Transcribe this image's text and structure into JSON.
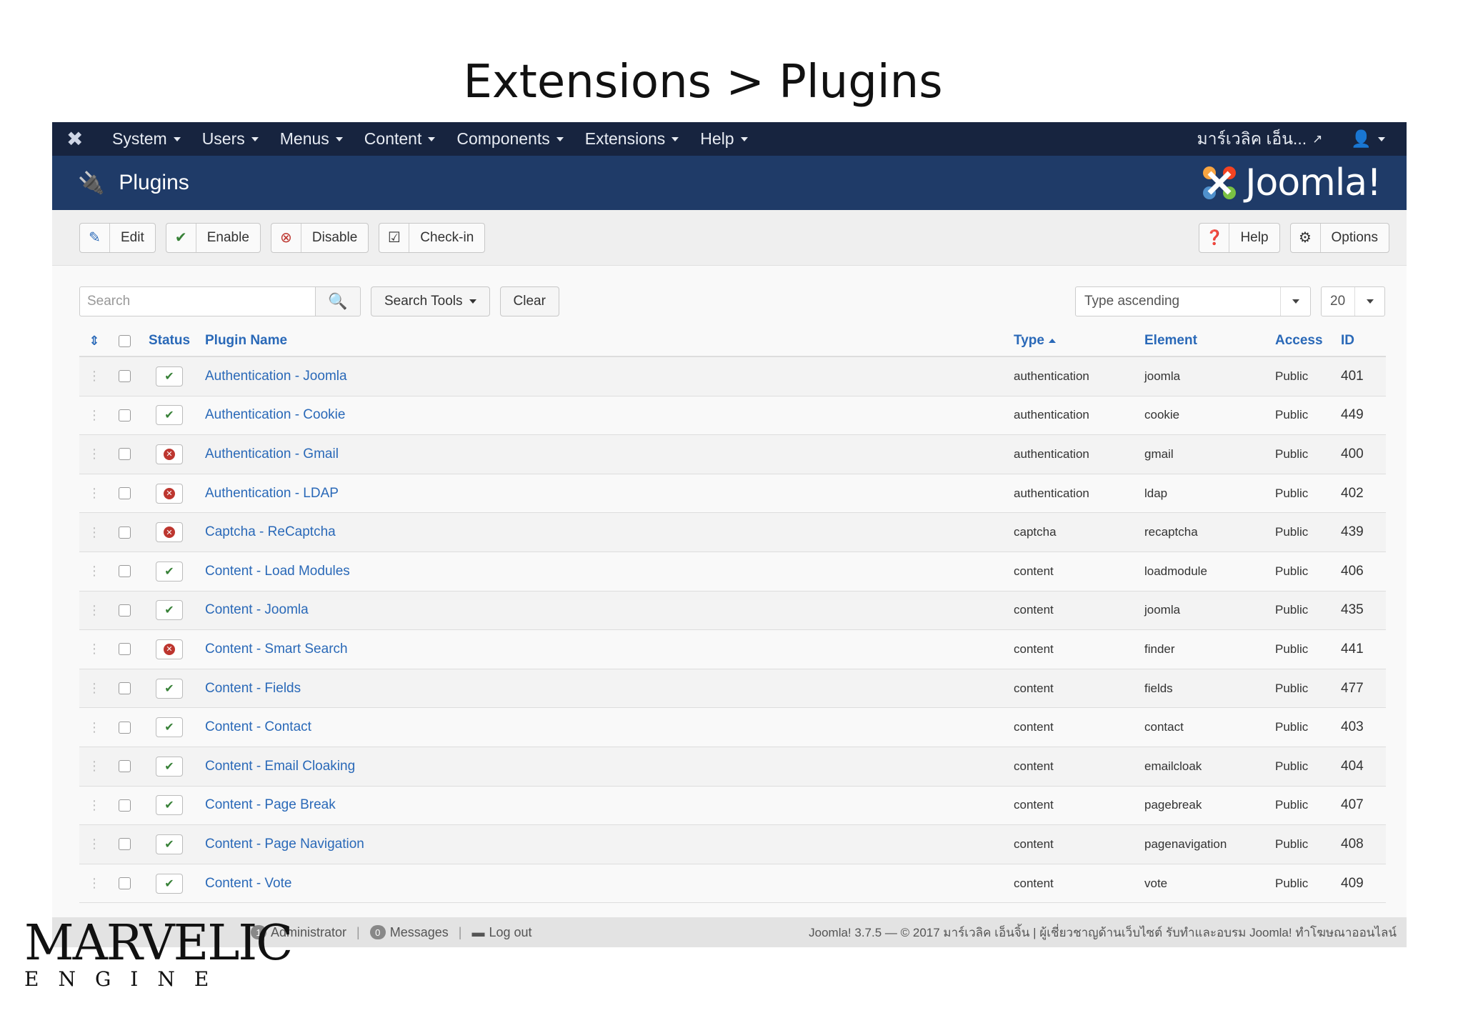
{
  "slide": {
    "title": "Extensions > Plugins"
  },
  "navbar": {
    "items": [
      "System",
      "Users",
      "Menus",
      "Content",
      "Components",
      "Extensions",
      "Help"
    ],
    "site_name": "มาร์เวลิค เอ็น...",
    "logo_icon": "joomla-icon"
  },
  "header": {
    "title": "Plugins",
    "brand": "Joomla!"
  },
  "toolbar": {
    "edit": "Edit",
    "enable": "Enable",
    "disable": "Disable",
    "checkin": "Check-in",
    "help": "Help",
    "options": "Options"
  },
  "filters": {
    "search_placeholder": "Search",
    "search_tools": "Search Tools",
    "clear": "Clear",
    "ordering": "Type ascending",
    "limit": "20"
  },
  "table": {
    "headers": {
      "status": "Status",
      "name": "Plugin Name",
      "type": "Type",
      "element": "Element",
      "access": "Access",
      "id": "ID"
    },
    "rows": [
      {
        "status": "enabled",
        "name": "Authentication - Joomla",
        "type": "authentication",
        "element": "joomla",
        "access": "Public",
        "id": "401"
      },
      {
        "status": "enabled",
        "name": "Authentication - Cookie",
        "type": "authentication",
        "element": "cookie",
        "access": "Public",
        "id": "449"
      },
      {
        "status": "disabled",
        "name": "Authentication - Gmail",
        "type": "authentication",
        "element": "gmail",
        "access": "Public",
        "id": "400"
      },
      {
        "status": "disabled",
        "name": "Authentication - LDAP",
        "type": "authentication",
        "element": "ldap",
        "access": "Public",
        "id": "402"
      },
      {
        "status": "disabled",
        "name": "Captcha - ReCaptcha",
        "type": "captcha",
        "element": "recaptcha",
        "access": "Public",
        "id": "439"
      },
      {
        "status": "enabled",
        "name": "Content - Load Modules",
        "type": "content",
        "element": "loadmodule",
        "access": "Public",
        "id": "406"
      },
      {
        "status": "enabled",
        "name": "Content - Joomla",
        "type": "content",
        "element": "joomla",
        "access": "Public",
        "id": "435"
      },
      {
        "status": "disabled",
        "name": "Content - Smart Search",
        "type": "content",
        "element": "finder",
        "access": "Public",
        "id": "441"
      },
      {
        "status": "enabled",
        "name": "Content - Fields",
        "type": "content",
        "element": "fields",
        "access": "Public",
        "id": "477"
      },
      {
        "status": "enabled",
        "name": "Content - Contact",
        "type": "content",
        "element": "contact",
        "access": "Public",
        "id": "403"
      },
      {
        "status": "enabled",
        "name": "Content - Email Cloaking",
        "type": "content",
        "element": "emailcloak",
        "access": "Public",
        "id": "404"
      },
      {
        "status": "enabled",
        "name": "Content - Page Break",
        "type": "content",
        "element": "pagebreak",
        "access": "Public",
        "id": "407"
      },
      {
        "status": "enabled",
        "name": "Content - Page Navigation",
        "type": "content",
        "element": "pagenavigation",
        "access": "Public",
        "id": "408"
      },
      {
        "status": "enabled",
        "name": "Content - Vote",
        "type": "content",
        "element": "vote",
        "access": "Public",
        "id": "409"
      }
    ]
  },
  "statusbar": {
    "admin_count": "1",
    "admin_label": "Administrator",
    "messages_count": "0",
    "messages_label": "Messages",
    "logout": "Log out",
    "copyright": "Joomla! 3.7.5 — © 2017 มาร์เวลิค เอ็นจิ้น | ผู้เชี่ยวชาญด้านเว็บไซต์ รับทำและอบรม Joomla! ทำโฆษณาออนไลน์"
  },
  "watermark": {
    "main": "MARVELIC",
    "sub": "ENGINE"
  },
  "colors": {
    "navbar": "#17243f",
    "header": "#1f3b68",
    "link": "#2a69b8",
    "enabled": "#378137",
    "disabled": "#bd362f"
  }
}
